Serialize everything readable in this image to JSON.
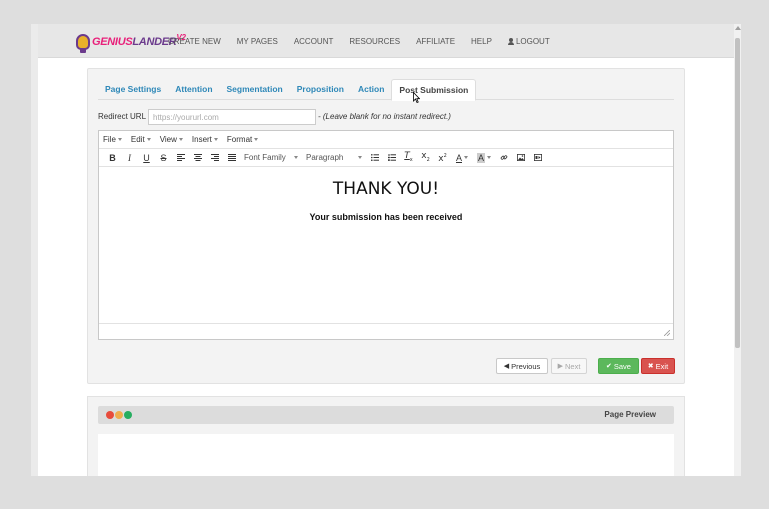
{
  "logo": {
    "genius": "GENIUS",
    "lander": "LANDER",
    "version": "V2"
  },
  "nav": {
    "items": [
      "CREATE NEW",
      "MY PAGES",
      "ACCOUNT",
      "RESOURCES",
      "AFFILIATE",
      "HELP"
    ],
    "logout": "LOGOUT"
  },
  "tabs": [
    "Page Settings",
    "Attention",
    "Segmentation",
    "Proposition",
    "Action",
    "Post Submission"
  ],
  "active_tab": "Post Submission",
  "redirect": {
    "label": "Redirect URL",
    "placeholder": "https://yoururl.com",
    "value": "",
    "hint": "- (Leave blank for no instant redirect.)"
  },
  "editor": {
    "menu": [
      "File",
      "Edit",
      "View",
      "Insert",
      "Format"
    ],
    "font_family": "Font Family",
    "paragraph": "Paragraph",
    "heading": "THANK YOU!",
    "message": "Your submission has been received"
  },
  "buttons": {
    "previous": "Previous",
    "next": "Next",
    "save": "Save",
    "exit": "Exit"
  },
  "preview": {
    "title": "Page Preview"
  },
  "colors": {
    "accent": "#2e88b8",
    "save": "#5cb85c",
    "exit": "#d9534f",
    "dot_red": "#e74c3c",
    "dot_yellow": "#f0ad4e",
    "dot_green": "#27ae60"
  }
}
